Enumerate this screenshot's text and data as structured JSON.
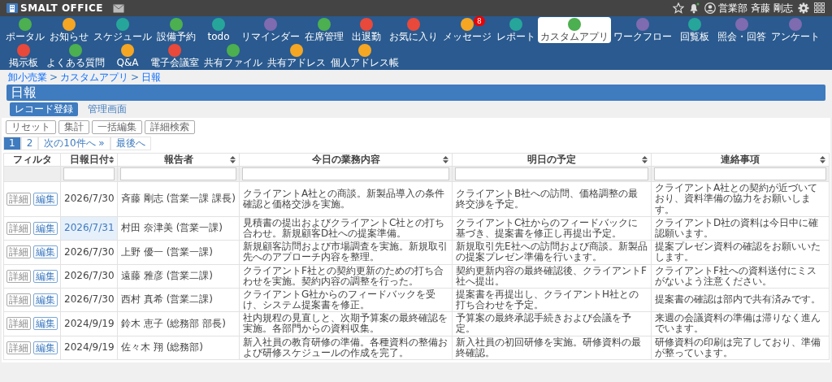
{
  "header": {
    "logo": "SMALT OFFICE",
    "user": "営業部 斉藤 剛志",
    "notification_dot": true
  },
  "apps": [
    [
      {
        "label": "ポータル",
        "color": "#4caf50",
        "selected": false
      },
      {
        "label": "お知らせ",
        "color": "#f5a623",
        "selected": false
      },
      {
        "label": "スケジュール",
        "color": "#26a69a",
        "selected": false
      },
      {
        "label": "設備予約",
        "color": "#4caf50",
        "selected": false
      },
      {
        "label": "todo",
        "color": "#26a69a",
        "selected": false
      },
      {
        "label": "リマインダー",
        "color": "#7e6bb0",
        "selected": false
      },
      {
        "label": "在席管理",
        "color": "#4caf50",
        "selected": false
      },
      {
        "label": "出退勤",
        "color": "#e8493a",
        "selected": false
      },
      {
        "label": "お気に入り",
        "color": "#e8493a",
        "selected": false
      },
      {
        "label": "メッセージ",
        "color": "#f5a623",
        "selected": false,
        "badge": "8"
      },
      {
        "label": "レポート",
        "color": "#26a69a",
        "selected": false
      },
      {
        "label": "カスタムアプリ",
        "color": "#4caf50",
        "selected": true
      },
      {
        "label": "ワークフロー",
        "color": "#7e6bb0",
        "selected": false
      },
      {
        "label": "回覧板",
        "color": "#26a69a",
        "selected": false
      },
      {
        "label": "照会・回答",
        "color": "#7e6bb0",
        "selected": false
      },
      {
        "label": "アンケート",
        "color": "#7e6bb0",
        "selected": false
      }
    ],
    [
      {
        "label": "掲示板",
        "color": "#e8493a",
        "selected": false
      },
      {
        "label": "よくある質問",
        "color": "#4caf50",
        "selected": false
      },
      {
        "label": "Q&A",
        "color": "#f5a623",
        "selected": false
      },
      {
        "label": "電子会議室",
        "color": "#e8493a",
        "selected": false
      },
      {
        "label": "共有ファイル",
        "color": "#4caf50",
        "selected": false
      },
      {
        "label": "共有アドレス",
        "color": "#f5a623",
        "selected": false
      },
      {
        "label": "個人アドレス帳",
        "color": "#f5a623",
        "selected": false
      }
    ]
  ],
  "breadcrumb": [
    {
      "kind": "link",
      "label": "卸小売業"
    },
    {
      "kind": "separator",
      "label": ">"
    },
    {
      "kind": "link",
      "label": "カスタムアプリ"
    },
    {
      "kind": "separator",
      "label": ">"
    },
    {
      "kind": "link",
      "label": "日報"
    }
  ],
  "title": "日報",
  "tabs": [
    {
      "label": "レコード登録",
      "selected": true
    },
    {
      "label": "管理画面",
      "selected": false
    }
  ],
  "toolbar": [
    "リセット",
    "集計",
    "一括編集",
    "詳細検索"
  ],
  "pagination": [
    {
      "label": "1",
      "selected": true
    },
    {
      "label": "2",
      "selected": false
    },
    {
      "label": "次の10件へ »",
      "selected": false
    },
    {
      "label": "最後へ",
      "selected": false
    }
  ],
  "table": {
    "columns": [
      {
        "label": "フィルタ",
        "sortable": false
      },
      {
        "label": "日報日付",
        "sortable": true
      },
      {
        "label": "報告者",
        "sortable": true
      },
      {
        "label": "今日の業務内容",
        "sortable": true
      },
      {
        "label": "明日の予定",
        "sortable": true
      },
      {
        "label": "連絡事項",
        "sortable": true
      }
    ],
    "rows": [
      {
        "actions": [
          "詳細",
          "編集"
        ],
        "date": "2026/7/30",
        "reporter": "斉藤 剛志 (営業一課 課長)",
        "today": "クライアントA社との商談。新製品導入の条件確認と価格交渉を実施。",
        "tomorrow": "クライアントB社への訪問、価格調整の最終交渉を予定。",
        "notes": "クライアントA社との契約が近づいており、資料準備の協力をお願いします。",
        "highlighted": false
      },
      {
        "actions": [
          "詳細",
          "編集"
        ],
        "date": "2026/7/31",
        "reporter": "村田 奈津美 (営業一課)",
        "today": "見積書の提出およびクライアントC社との打ち合わせ。新規顧客D社への提案準備。",
        "tomorrow": "クライアントC社からのフィードバックに基づき、提案書を修正し再提出予定。",
        "notes": "クライアントD社の資料は今日中に確認願います。",
        "highlighted": true
      },
      {
        "actions": [
          "詳細",
          "編集"
        ],
        "date": "2026/7/30",
        "reporter": "上野 優一 (営業一課)",
        "today": "新規顧客訪問および市場調査を実施。新規取引先へのアプローチ内容を整理。",
        "tomorrow": "新規取引先E社への訪問および商談。新製品の提案プレゼン準備を行います。",
        "notes": "提案プレゼン資料の確認をお願いいたします。",
        "highlighted": false
      },
      {
        "actions": [
          "詳細",
          "編集"
        ],
        "date": "2026/7/30",
        "reporter": "遠藤 雅彦 (営業二課)",
        "today": "クライアントF社との契約更新のための打ち合わせを実施。契約内容の調整を行った。",
        "tomorrow": "契約更新内容の最終確認後、クライアントF社へ提出。",
        "notes": "クライアントF社への資料送付にミスがないよう注意ください。",
        "highlighted": false
      },
      {
        "actions": [
          "詳細",
          "編集"
        ],
        "date": "2026/7/30",
        "reporter": "西村 真希 (営業二課)",
        "today": "クライアントG社からのフィードバックを受け、システム提案書を修正。",
        "tomorrow": "提案書を再提出し、クライアントH社との打ち合わせを予定。",
        "notes": "提案書の確認は部内で共有済みです。",
        "highlighted": false
      },
      {
        "actions": [
          "詳細",
          "編集"
        ],
        "date": "2024/9/19",
        "reporter": "鈴木 恵子 (総務部 部長)",
        "today": "社内規程の見直しと、次期予算案の最終確認を実施。各部門からの資料収集。",
        "tomorrow": "予算案の最終承認手続きおよび会議を予定。",
        "notes": "来週の会議資料の準備は滞りなく進んでいます。",
        "highlighted": false
      },
      {
        "actions": [
          "詳細",
          "編集"
        ],
        "date": "2024/9/19",
        "reporter": "佐々木 翔 (総務部)",
        "today": "新入社員の教育研修の準備。各種資料の整備および研修スケジュールの作成を完了。",
        "tomorrow": "新入社員の初回研修を実施。研修資料の最終確認。",
        "notes": "研修資料の印刷は完了しており、準備が整っています。",
        "highlighted": false
      }
    ]
  }
}
